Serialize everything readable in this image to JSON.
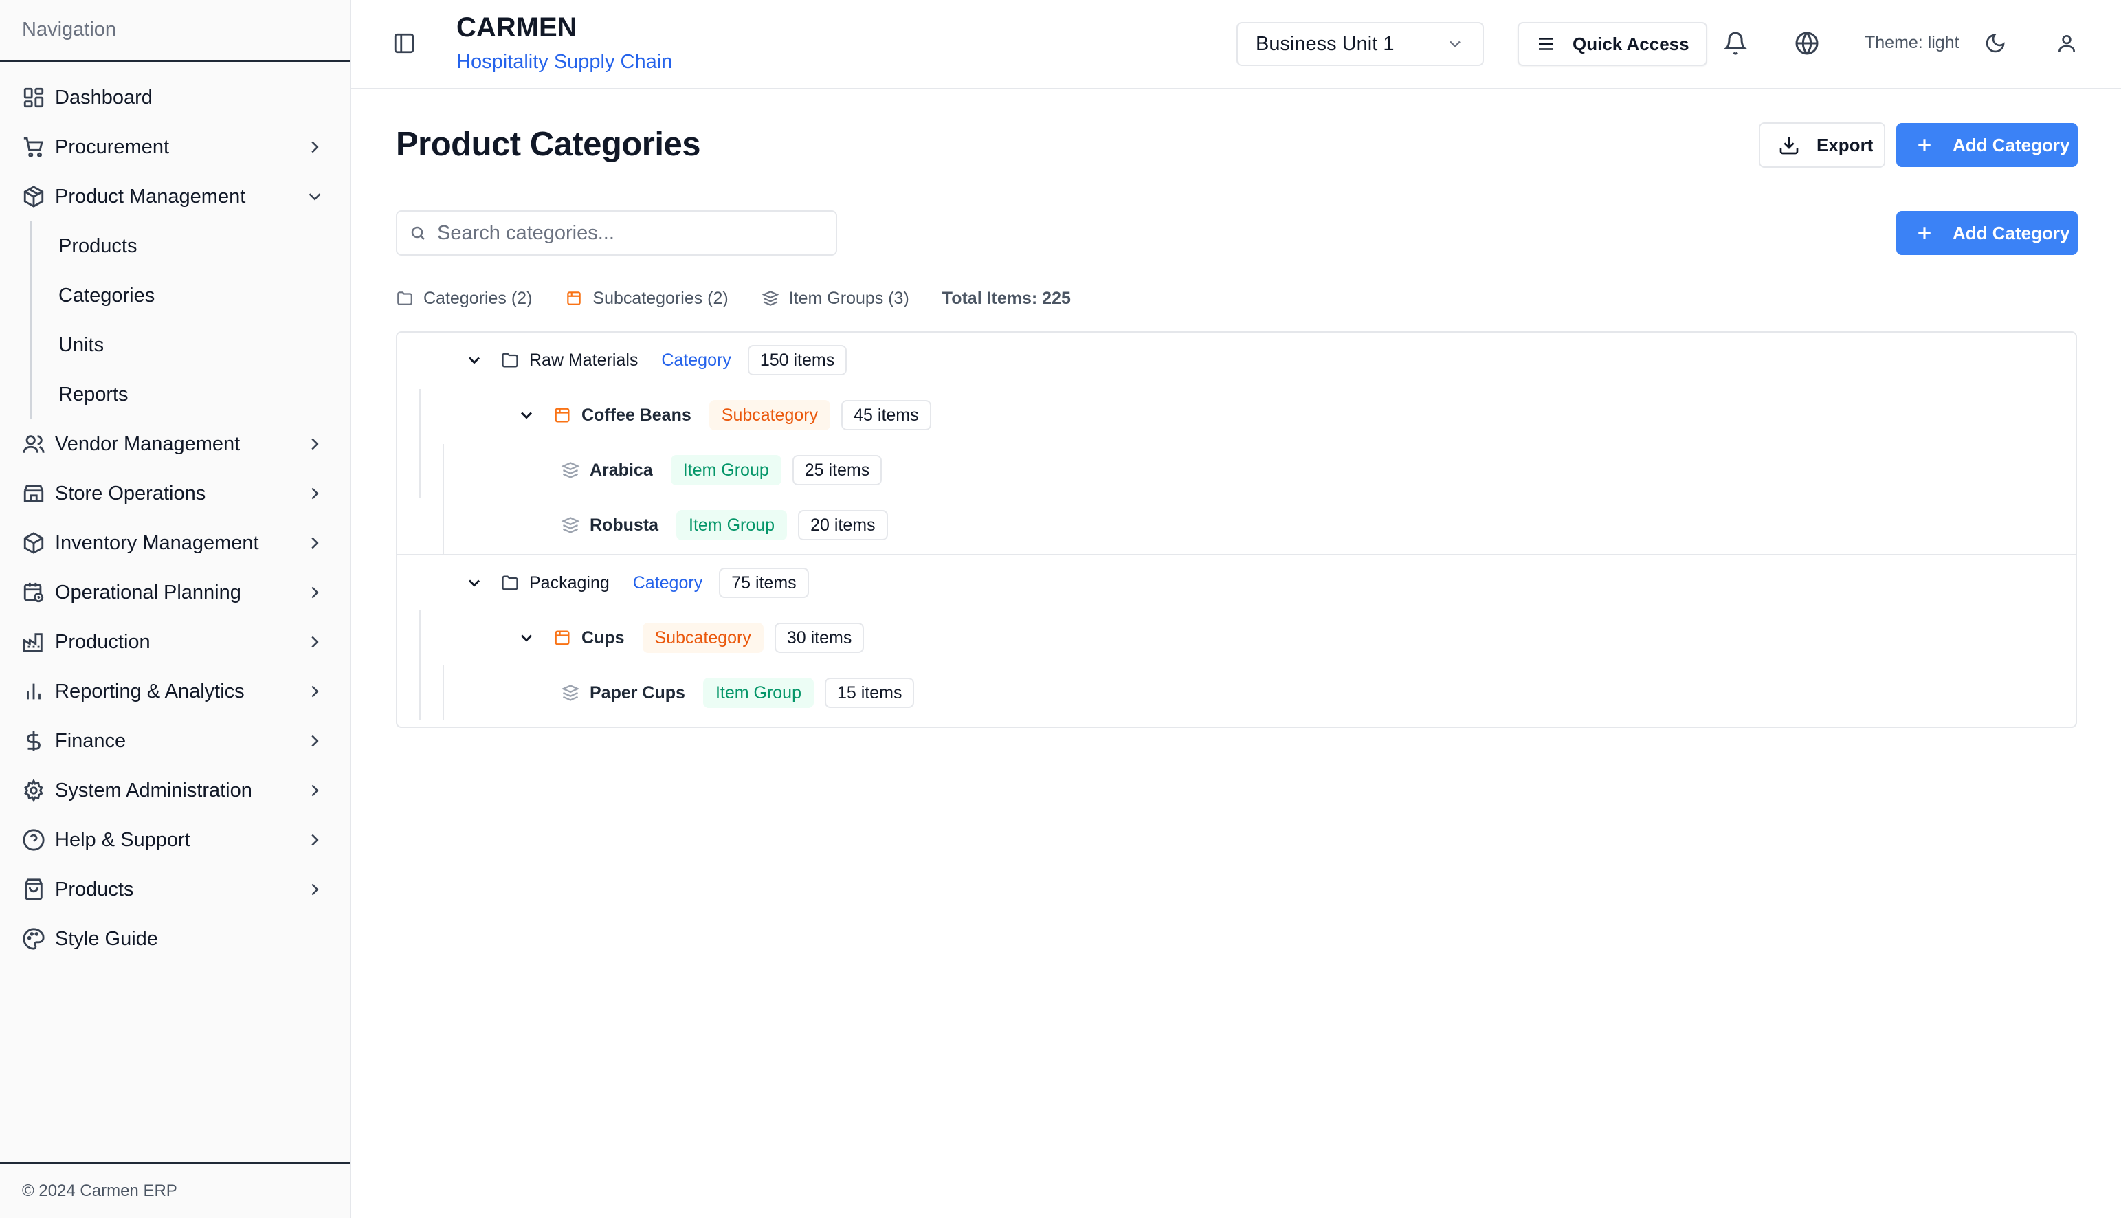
{
  "sidebar": {
    "header": "Navigation",
    "items": [
      {
        "label": "Dashboard"
      },
      {
        "label": "Procurement"
      },
      {
        "label": "Product Management"
      },
      {
        "label": "Vendor Management"
      },
      {
        "label": "Store Operations"
      },
      {
        "label": "Inventory Management"
      },
      {
        "label": "Operational Planning"
      },
      {
        "label": "Production"
      },
      {
        "label": "Reporting & Analytics"
      },
      {
        "label": "Finance"
      },
      {
        "label": "System Administration"
      },
      {
        "label": "Help & Support"
      },
      {
        "label": "Products"
      },
      {
        "label": "Style Guide"
      }
    ],
    "product_management_sub": [
      {
        "label": "Products"
      },
      {
        "label": "Categories"
      },
      {
        "label": "Units"
      },
      {
        "label": "Reports"
      }
    ],
    "footer": "© 2024 Carmen ERP"
  },
  "header": {
    "app_name": "CARMEN",
    "app_subtitle": "Hospitality Supply Chain",
    "business_unit": "Business Unit 1",
    "quick_access": "Quick Access",
    "theme_label": "Theme: light"
  },
  "page": {
    "title": "Product Categories",
    "export_label": "Export",
    "add_category_label": "Add Category",
    "search_placeholder": "Search categories...",
    "stats": {
      "categories": "Categories (2)",
      "subcategories": "Subcategories (2)",
      "item_groups": "Item Groups (3)",
      "total": "Total Items: 225"
    }
  },
  "tree": {
    "nodes": [
      {
        "name": "Raw Materials",
        "type": "Category",
        "count": "150 items"
      },
      {
        "name": "Coffee Beans",
        "type": "Subcategory",
        "count": "45 items"
      },
      {
        "name": "Arabica",
        "type": "Item Group",
        "count": "25 items"
      },
      {
        "name": "Robusta",
        "type": "Item Group",
        "count": "20 items"
      },
      {
        "name": "Packaging",
        "type": "Category",
        "count": "75 items"
      },
      {
        "name": "Cups",
        "type": "Subcategory",
        "count": "30 items"
      },
      {
        "name": "Paper Cups",
        "type": "Item Group",
        "count": "15 items"
      }
    ]
  },
  "colors": {
    "primary": "#3b82f6",
    "category": "#2563eb",
    "subcategory": "#ea580c",
    "item_group": "#059669"
  }
}
